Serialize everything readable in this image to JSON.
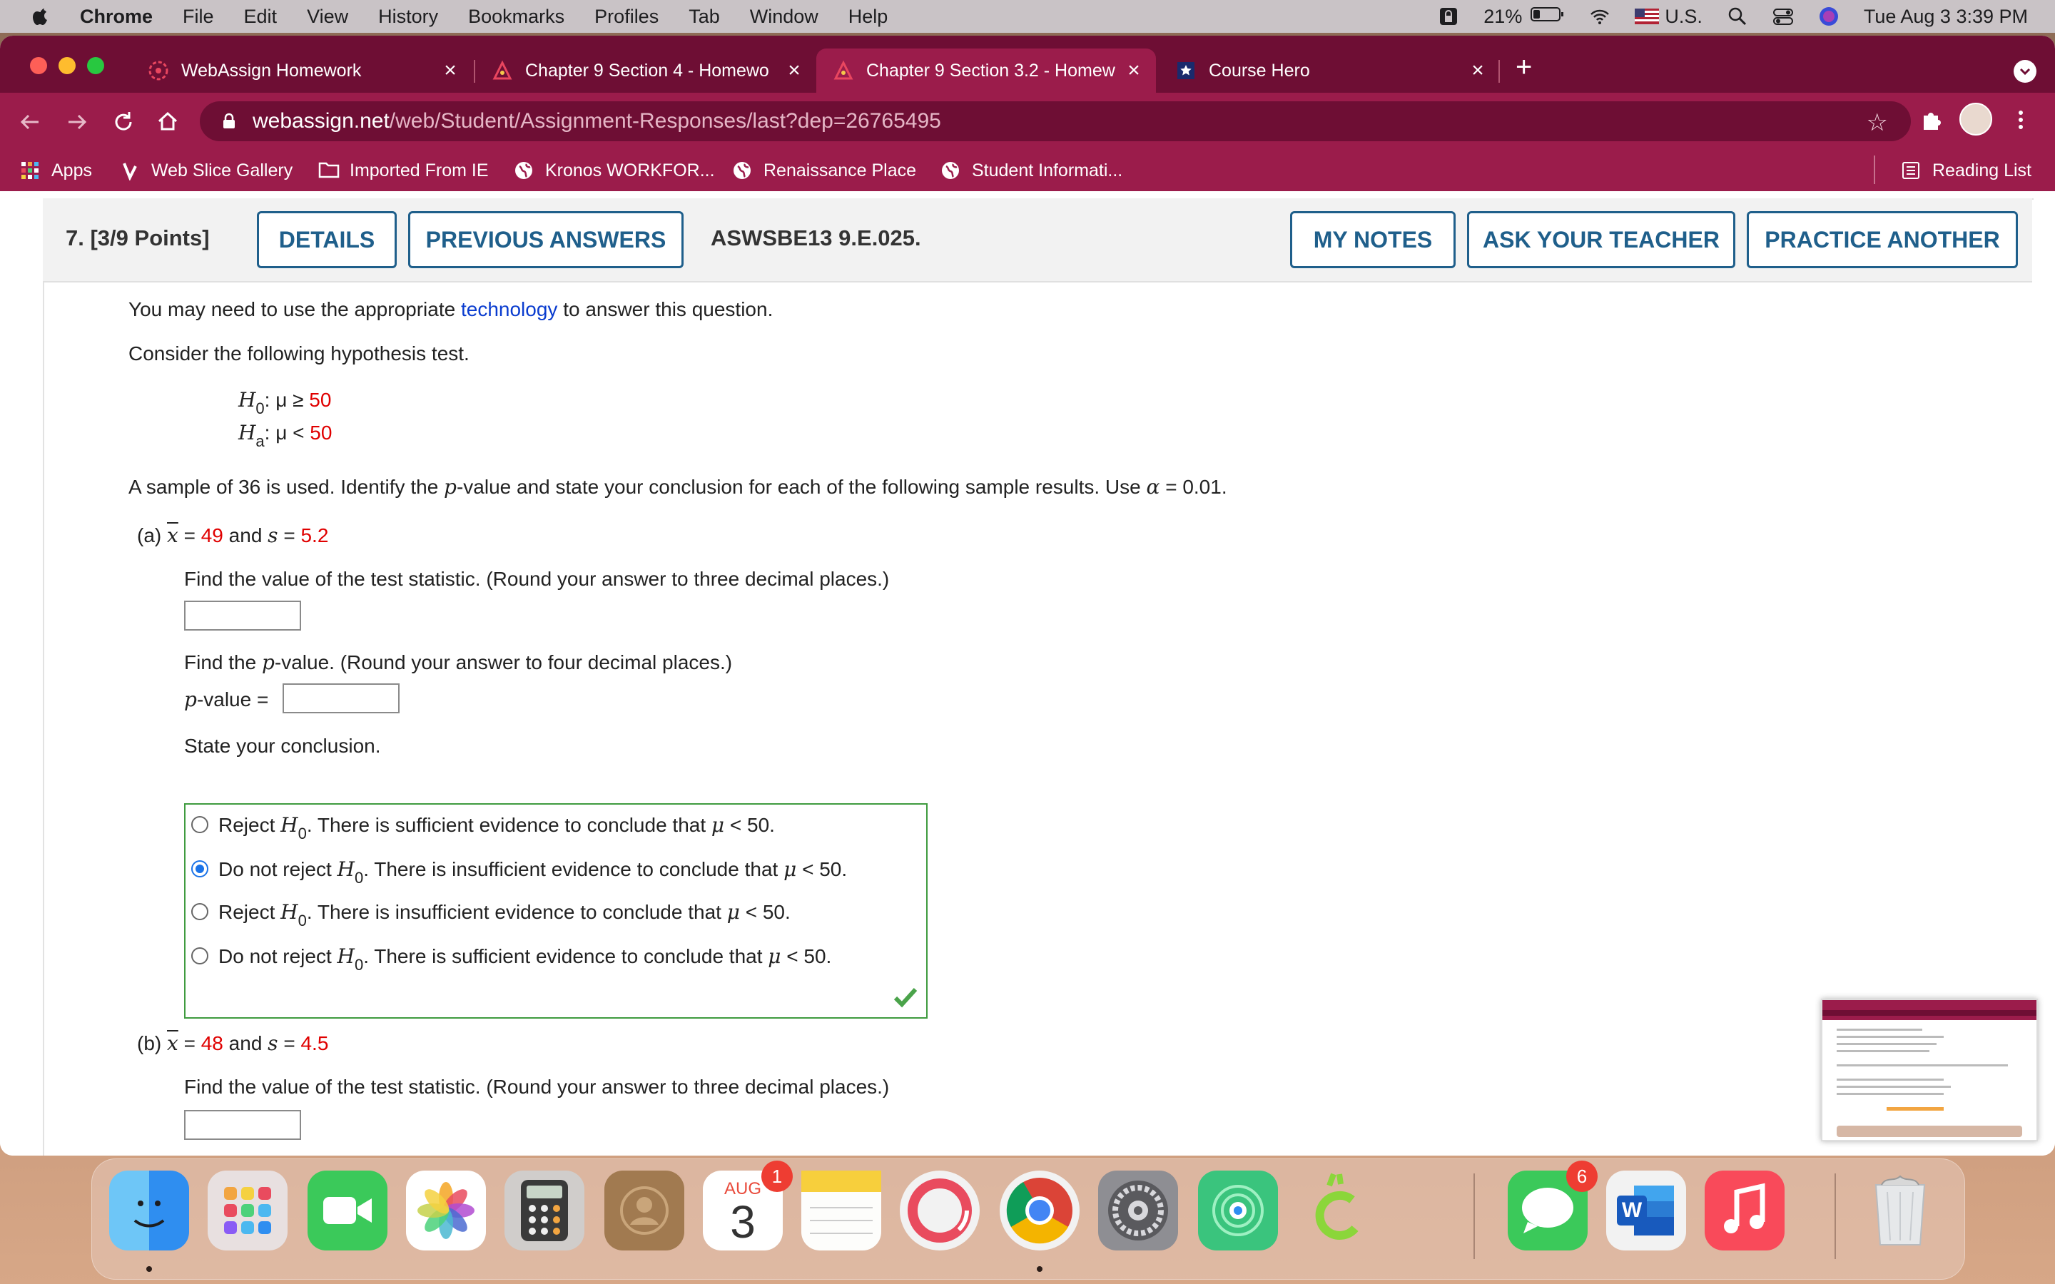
{
  "menubar": {
    "app": "Chrome",
    "items": [
      "File",
      "Edit",
      "View",
      "History",
      "Bookmarks",
      "Profiles",
      "Tab",
      "Window",
      "Help"
    ],
    "battery": "21%",
    "input_source": "U.S.",
    "clock": "Tue Aug 3  3:39 PM"
  },
  "tabs": [
    {
      "title": "WebAssign Homework",
      "icon": "webassign-icon",
      "active": false
    },
    {
      "title": "Chapter 9 Section 4 - Homewo",
      "icon": "webassign-icon",
      "active": false
    },
    {
      "title": "Chapter 9 Section 3.2 - Homew",
      "icon": "webassign-icon",
      "active": true
    },
    {
      "title": "Course Hero",
      "icon": "course-hero-icon",
      "active": false
    }
  ],
  "toolbar": {
    "url_host": "webassign.net",
    "url_path": "/web/Student/Assignment-Responses/last?dep=26765495"
  },
  "bookmarks": {
    "items": [
      "Apps",
      "Web Slice Gallery",
      "Imported From IE",
      "Kronos WORKFOR...",
      "Renaissance Place",
      "Student Informati..."
    ],
    "reading_list": "Reading List"
  },
  "question": {
    "number": "7.",
    "points": "[3/9 Points]",
    "details_label": "DETAILS",
    "prev_answers_label": "PREVIOUS ANSWERS",
    "code": "ASWSBE13 9.E.025.",
    "notes_label": "MY NOTES",
    "ask_label": "ASK YOUR TEACHER",
    "practice_label": "PRACTICE ANOTHER",
    "intro_prefix": "You may need to use the appropriate",
    "intro_link": "technology",
    "intro_suffix": "to answer this question.",
    "consider": "Consider the following hypothesis test.",
    "h0_letter": "H",
    "h0_sub": "0",
    "h0_rel": ": μ ≥",
    "h0_val": "50",
    "ha_letter": "H",
    "ha_sub": "a",
    "ha_rel": ": μ <",
    "ha_val": "50",
    "sample_text_1": "A sample of 36 is used. Identify the",
    "sample_p": "p",
    "sample_text_2": "-value and state your conclusion for each of the following sample results. Use",
    "sample_alpha": "α",
    "sample_text_3": "= 0.01."
  },
  "part_a": {
    "label": "(a)",
    "xbar": "x",
    "eq1": "=",
    "xval": "49",
    "and_s": "and",
    "s": "s",
    "eq2": "=",
    "sval": "5.2",
    "stat_prompt": "Find the value of the test statistic. (Round your answer to three decimal places.)",
    "p_prompt_1": "Find the",
    "p_prompt_p": "p",
    "p_prompt_2": "-value. (Round your answer to four decimal places.)",
    "pvalue_p": "p",
    "pvalue_label": "-value =",
    "conclusion_prompt": "State your conclusion.",
    "choices": [
      {
        "pre": "Reject",
        "post": ". There is sufficient evidence to conclude that",
        "tail": "< 50.",
        "selected": false
      },
      {
        "pre": "Do not reject",
        "post": ". There is insufficient evidence to conclude that",
        "tail": "< 50.",
        "selected": true
      },
      {
        "pre": "Reject",
        "post": ". There is insufficient evidence to conclude that",
        "tail": "< 50.",
        "selected": false
      },
      {
        "pre": "Do not reject",
        "post": ". There is sufficient evidence to conclude that",
        "tail": "< 50.",
        "selected": false
      }
    ],
    "choice_h": "H",
    "choice_sub": "0",
    "choice_mu": "μ"
  },
  "part_b": {
    "label": "(b)",
    "xbar": "x",
    "eq1": "=",
    "xval": "48",
    "and_s": "and",
    "s": "s",
    "eq2": "=",
    "sval": "4.5",
    "stat_prompt": "Find the value of the test statistic. (Round your answer to three decimal places.)"
  },
  "dock": {
    "calendar_month": "AUG",
    "calendar_day": "3",
    "calendar_badge": "1",
    "messages_badge": "6",
    "apps": [
      "finder",
      "launchpad",
      "facetime",
      "photos",
      "calculator",
      "contacts",
      "calendar",
      "notes",
      "screen-time",
      "chrome",
      "system-preferences",
      "find-my",
      "sketch-app",
      "messages",
      "word",
      "music",
      "trash"
    ]
  },
  "colors": {
    "tabstrip": "#6e0e34",
    "toolbar": "#9b1c4b",
    "button_border": "#1f5f8b",
    "value_red": "#e00000",
    "correct_green": "#3f9b3f"
  }
}
